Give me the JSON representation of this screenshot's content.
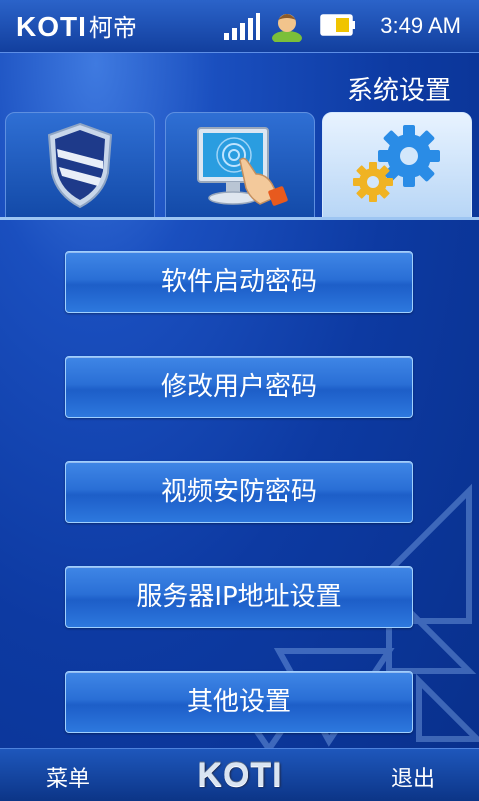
{
  "status_bar": {
    "brand": "KOTI",
    "brand_cn": "柯帝",
    "time": "3:49 AM",
    "icons": [
      "signal-icon",
      "user-avatar-icon",
      "battery-icon"
    ]
  },
  "section_title": "系统设置",
  "tabs": [
    {
      "icon": "shield-icon",
      "active": false
    },
    {
      "icon": "touch-monitor-icon",
      "active": false
    },
    {
      "icon": "gears-icon",
      "active": true
    }
  ],
  "menu": [
    {
      "label": "软件启动密码"
    },
    {
      "label": "修改用户密码"
    },
    {
      "label": "视频安防密码"
    },
    {
      "label": "服务器IP地址设置"
    },
    {
      "label": "其他设置"
    }
  ],
  "bottom_bar": {
    "left": "菜单",
    "logo": "KOTI",
    "right": "退出"
  },
  "colors": {
    "background": "#0d3aa2",
    "button": "#2a6fd6",
    "active_tab": "#d3e7fb"
  }
}
